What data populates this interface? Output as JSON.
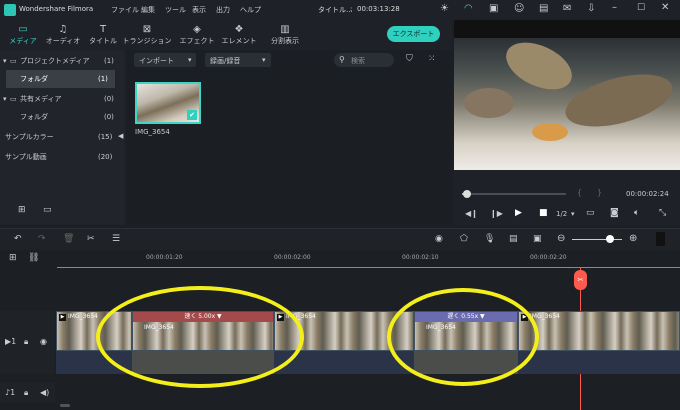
{
  "app": {
    "name": "Wondershare Filmora",
    "menu": [
      "ファイル",
      "編集",
      "ツール",
      "表示",
      "出力",
      "ヘルプ"
    ],
    "project_title": "タイトル...",
    "timecode": "00:03:13:28"
  },
  "toolbar": {
    "tabs": [
      {
        "label": "メディア",
        "icon": "folder-icon",
        "active": true
      },
      {
        "label": "オーディオ",
        "icon": "music-note-icon"
      },
      {
        "label": "タイトル",
        "icon": "text-icon"
      },
      {
        "label": "トランジション",
        "icon": "transition-icon"
      },
      {
        "label": "エフェクト",
        "icon": "effects-icon"
      },
      {
        "label": "エレメント",
        "icon": "elements-icon"
      },
      {
        "label": "分割表示",
        "icon": "split-screen-icon"
      }
    ],
    "export_label": "エクスポート"
  },
  "sidebar": {
    "items": [
      {
        "label": "プロジェクトメディア",
        "count": "(1)",
        "expanded": true
      },
      {
        "label": "フォルダ",
        "count": "(1)",
        "selected": true
      },
      {
        "label": "共有メディア",
        "count": "(0)",
        "expanded": true
      },
      {
        "label": "フォルダ",
        "count": "(0)"
      },
      {
        "label": "サンプルカラー",
        "count": "(15)"
      },
      {
        "label": "サンプル動画",
        "count": "(20)"
      }
    ]
  },
  "media": {
    "import_label": "インポート",
    "record_label": "録画/録音",
    "search_placeholder": "検索",
    "items": [
      {
        "name": "IMG_3654"
      }
    ]
  },
  "preview": {
    "time": "00:00:02:24",
    "quality": "1/2",
    "progress_fraction": 0.05
  },
  "ruler": {
    "ticks": [
      "00:00:01:20",
      "00:00:02:00",
      "00:00:02:10",
      "00:00:02:20"
    ]
  },
  "timeline": {
    "clips": [
      {
        "label": "IMG_3654"
      },
      {
        "label": "IMG_3654",
        "speed": "速く 5.00x ▼"
      },
      {
        "label": "IMG_3654"
      },
      {
        "label": "IMG_3654",
        "speed": "遅く 0.55x ▼"
      },
      {
        "label": "IMG_3654"
      }
    ]
  },
  "colors": {
    "accent": "#3dd6c6",
    "playhead": "#ff5a4e",
    "highlight": "#f4ee1a",
    "speed_fast": "#a54a4a",
    "speed_slow": "#6b6bb0"
  }
}
